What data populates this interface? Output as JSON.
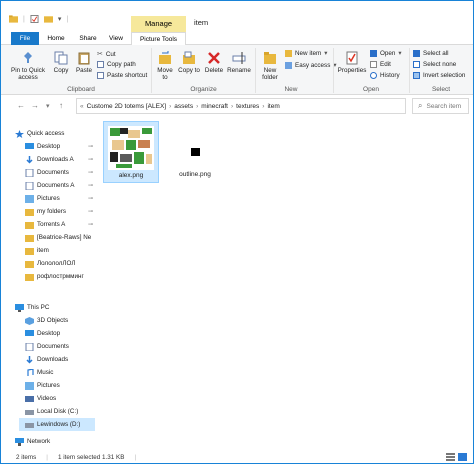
{
  "window": {
    "title": "item",
    "context_tab": "Manage"
  },
  "tabs": {
    "file": "File",
    "home": "Home",
    "share": "Share",
    "view": "View",
    "picture_tools": "Picture Tools"
  },
  "ribbon": {
    "clipboard": {
      "pin_label": "Pin to Quick access",
      "copy_label": "Copy",
      "paste_label": "Paste",
      "cut_label": "Cut",
      "copy_path_label": "Copy path",
      "paste_shortcut_label": "Paste shortcut",
      "group_label": "Clipboard"
    },
    "organize": {
      "move_to_label": "Move to",
      "copy_to_label": "Copy to",
      "delete_label": "Delete",
      "rename_label": "Rename",
      "group_label": "Organize"
    },
    "new": {
      "new_folder_label": "New folder",
      "new_item_label": "New item",
      "easy_access_label": "Easy access",
      "group_label": "New"
    },
    "open": {
      "properties_label": "Properties",
      "open_label": "Open",
      "edit_label": "Edit",
      "history_label": "History",
      "group_label": "Open"
    },
    "select": {
      "select_all_label": "Select all",
      "select_none_label": "Select none",
      "invert_label": "Invert selection",
      "group_label": "Select"
    }
  },
  "address": {
    "crumbs": [
      "Custome 2D totems [ALEX]",
      "assets",
      "minecraft",
      "textures",
      "item"
    ],
    "search_placeholder": "Search item"
  },
  "nav": {
    "quick_access": "Quick access",
    "items": [
      {
        "label": "Desktop",
        "pinned": true
      },
      {
        "label": "Downloads A",
        "pinned": true
      },
      {
        "label": "Documents",
        "pinned": true
      },
      {
        "label": "Documents A",
        "pinned": true
      },
      {
        "label": "Pictures",
        "pinned": true
      },
      {
        "label": "my folders",
        "pinned": true
      },
      {
        "label": "Torrents A",
        "pinned": true
      },
      {
        "label": "[Beatrice-Raws] Ne",
        "pinned": false
      },
      {
        "label": "item",
        "pinned": false
      },
      {
        "label": "ЛолололЛОЛ",
        "pinned": false
      },
      {
        "label": "рофлострмминг",
        "pinned": false
      }
    ],
    "this_pc": "This PC",
    "pc_items": [
      "3D Objects",
      "Desktop",
      "Documents",
      "Downloads",
      "Music",
      "Pictures",
      "Videos",
      "Local Disk (C:)",
      "Lewindows (D:)"
    ],
    "network": "Network"
  },
  "files": [
    {
      "name": "alex.png",
      "selected": true
    },
    {
      "name": "outline.png",
      "selected": false
    }
  ],
  "status": {
    "count": "2 items",
    "selection": "1 item selected  1.31 KB"
  }
}
